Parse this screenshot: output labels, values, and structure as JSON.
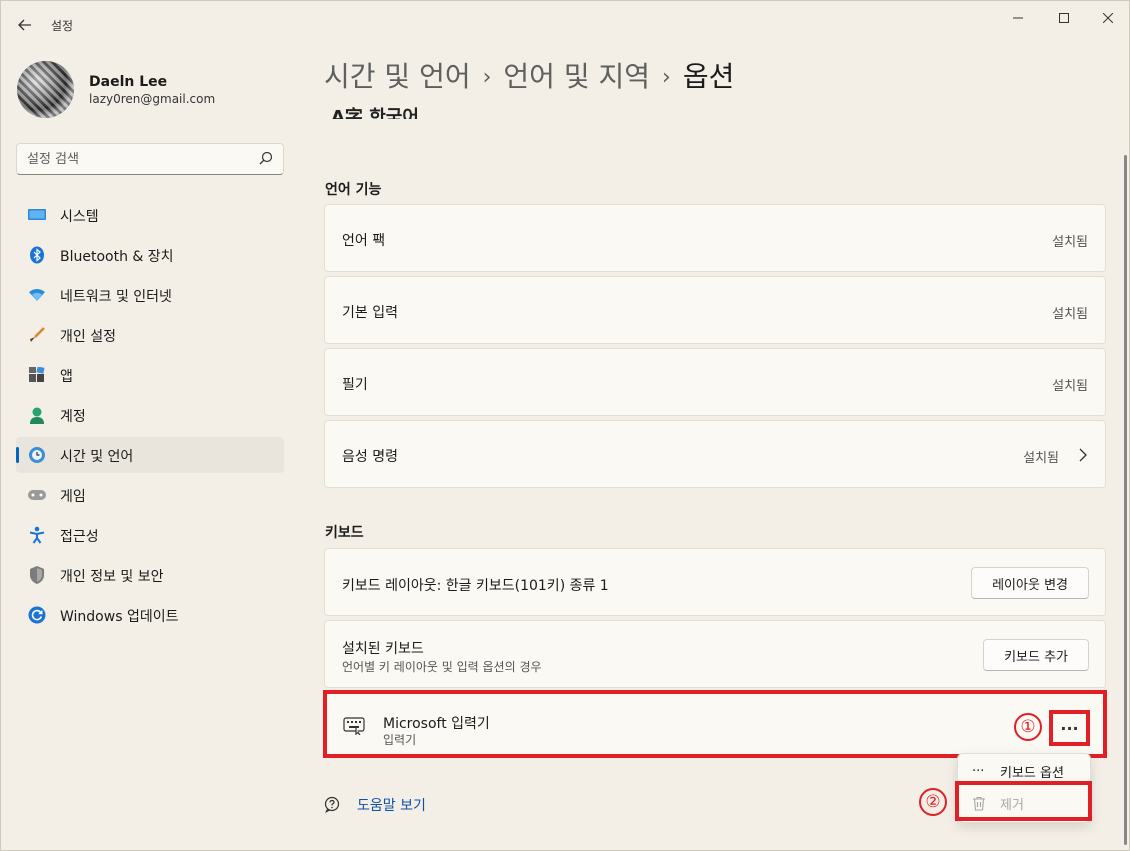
{
  "app": {
    "title": "설정"
  },
  "window_controls": {
    "minimize": "—",
    "maximize": "☐",
    "close": "✕"
  },
  "profile": {
    "name": "Daeln Lee",
    "email": "lazy0ren@gmail.com"
  },
  "search": {
    "placeholder": "설정 검색"
  },
  "nav": [
    {
      "label": "시스템",
      "icon": "monitor-icon"
    },
    {
      "label": "Bluetooth & 장치",
      "icon": "bluetooth-icon"
    },
    {
      "label": "네트워크 및 인터넷",
      "icon": "wifi-icon"
    },
    {
      "label": "개인 설정",
      "icon": "brush-icon"
    },
    {
      "label": "앱",
      "icon": "apps-icon"
    },
    {
      "label": "계정",
      "icon": "person-icon"
    },
    {
      "label": "시간 및 언어",
      "icon": "globe-clock-icon",
      "active": true
    },
    {
      "label": "게임",
      "icon": "gamepad-icon"
    },
    {
      "label": "접근성",
      "icon": "accessibility-icon"
    },
    {
      "label": "개인 정보 및 보안",
      "icon": "shield-icon"
    },
    {
      "label": "Windows 업데이트",
      "icon": "update-icon"
    }
  ],
  "breadcrumb": {
    "part1": "시간 및 언어",
    "part2": "언어 및 지역",
    "current": "옵션",
    "sep": "›"
  },
  "header_cutoff": "A字 한국어",
  "language_features": {
    "title": "언어 기능",
    "items": [
      {
        "label": "언어 팩",
        "status": "설치됨"
      },
      {
        "label": "기본 입력",
        "status": "설치됨"
      },
      {
        "label": "필기",
        "status": "설치됨"
      },
      {
        "label": "음성 명령",
        "status": "설치됨"
      }
    ]
  },
  "keyboard": {
    "title": "키보드",
    "layout_label": "키보드 레이아웃: 한글 키보드(101키) 종류 1",
    "layout_button": "레이아웃 변경",
    "installed_label": "설치된 키보드",
    "installed_sub": "언어별 키 레이아웃 및 입력 옵션의 경우",
    "add_button": "키보드 추가",
    "ime_name": "Microsoft 입력기",
    "ime_sub": "입력기",
    "more": "···"
  },
  "context_menu": {
    "items": [
      {
        "label": "키보드 옵션",
        "icon": "···"
      },
      {
        "label": "제거",
        "disabled": true
      }
    ]
  },
  "annotations": {
    "step1": "①",
    "step2": "②",
    "highlight_color": "#e01f26"
  },
  "help": {
    "label": "도움말 보기"
  }
}
